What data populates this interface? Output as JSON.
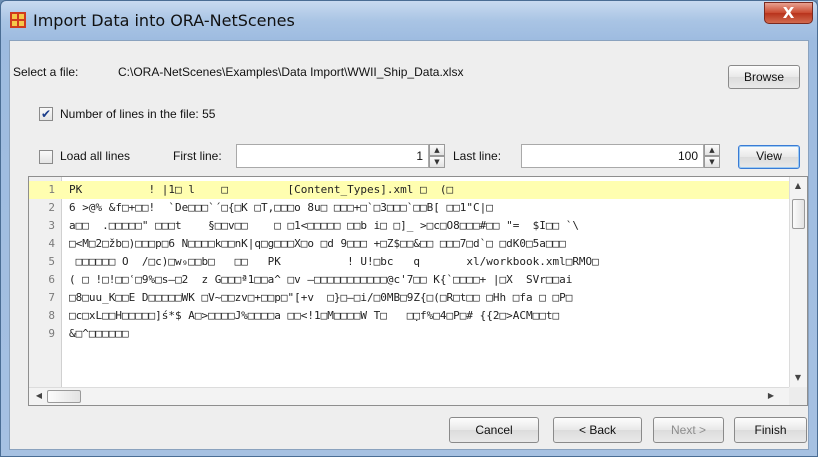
{
  "window": {
    "title": "Import Data into ORA-NetScenes",
    "close_label": "X"
  },
  "file": {
    "label": "Select a file:",
    "path": "C:\\ORA-NetScenes\\Examples\\Data Import\\WWII_Ship_Data.xlsx",
    "browse_label": "Browse"
  },
  "lines_info": {
    "checked": true,
    "label": "Number of lines in the file: 55"
  },
  "range": {
    "load_all_checked": false,
    "load_all_label": "Load all lines",
    "first_label": "First line:",
    "first_value": "1",
    "last_label": "Last line:",
    "last_value": "100",
    "view_label": "View"
  },
  "preview": {
    "lines": [
      {
        "num": "1",
        "text": "PK          ! |1□ l    □         [Content_Types].xml □  (□"
      },
      {
        "num": "2",
        "text": "6 >@% &f□+□□!  `De□□□`´□{□K □T,□□□o 8u□ □□□+□`□3□□□`□□B[ □□1\"C|□"
      },
      {
        "num": "3",
        "text": "a□□  .□□□□□\" □□□t    §□□v□□    □ □1<□□□□□ □□b i□ □]_ >□c□O8□□□#□□ \"=  $I□□ `\\"
      },
      {
        "num": "4",
        "text": "□<M□2□žb□)□□□p□6 N□□□□k□□nK|q□g□□□X□o □d 9□□□ +□Z$□□&□□ □□□7□d`□ □dK0□5a□□□"
      },
      {
        "num": "5",
        "text": " □□□□□□ O  /□c)□w₉□□b□   □□   PK          ! U!□bc   q       xl/workbook.xml□RMO□"
      },
      {
        "num": "6",
        "text": "( □ !□!□□ʿ□9%□s–□2  z G□□□ª1□□a^ □v –□□□□□□□□□□□@c'7□□ K{`□□□□+ |□X  SVr□□ai"
      },
      {
        "num": "7",
        "text": "□8□uu_K□□E D□□□□□WK □V~□□zv□+□□p□\"[+v  □}□–□i/□0MB□9Z{□(□R□t□□ □Hh □fa □ □P□"
      },
      {
        "num": "8",
        "text": "□c□xL□□H□□□□□]ś*$ A□>□□□□J%□□□□a □□<!1□M□□□□W T□   □̣□f%□4□P□# {{2□>ACM□□t□"
      },
      {
        "num": "9",
        "text": "&□^□□□□□□"
      }
    ]
  },
  "footer": {
    "cancel_label": "Cancel",
    "back_label": "< Back",
    "next_label": "Next >",
    "finish_label": "Finish"
  },
  "colors": {
    "active_line": "#fffeb0",
    "close_button": "#c9492f"
  },
  "icons": {
    "app": "ora-grid-icon",
    "close": "close-icon"
  }
}
